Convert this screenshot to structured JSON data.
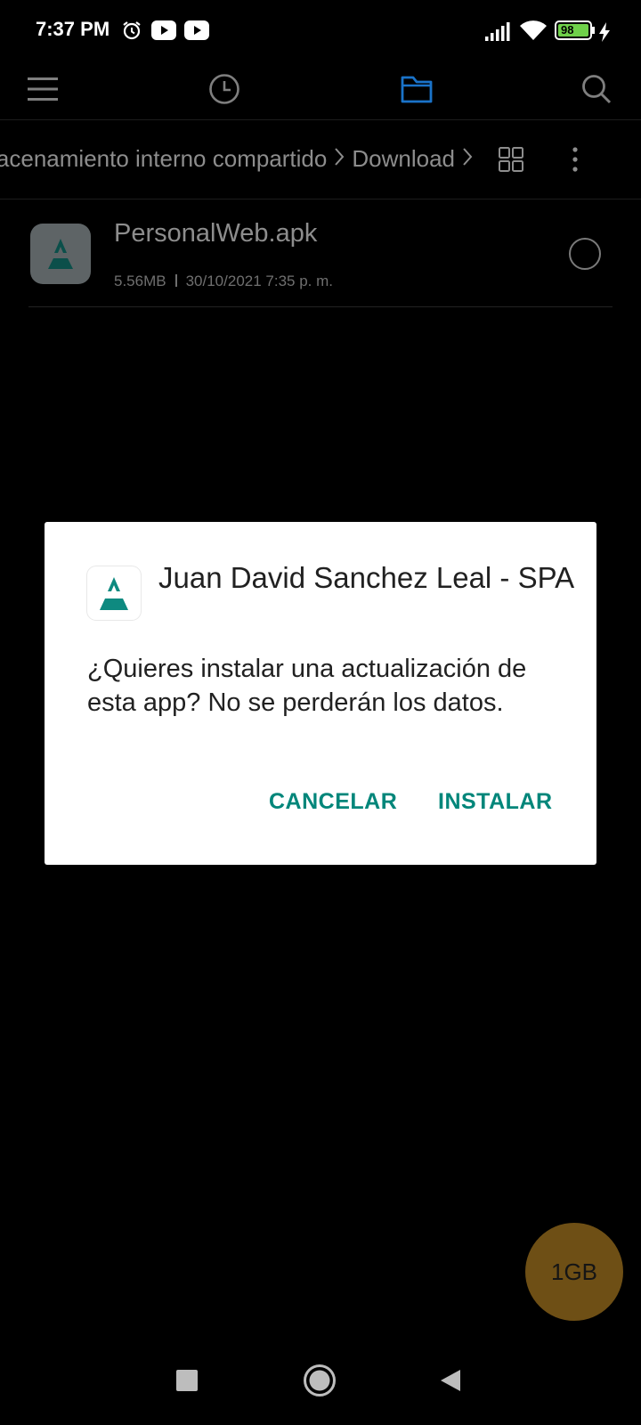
{
  "status_bar": {
    "time": "7:37 PM",
    "battery_level": "98",
    "icons": [
      "alarm-icon",
      "youtube-icon",
      "youtube-icon",
      "signal-icon",
      "wifi-icon",
      "battery-icon",
      "charging-icon"
    ]
  },
  "toolbar": {
    "icons": [
      "menu-icon",
      "history-icon",
      "folder-icon",
      "search-icon"
    ],
    "active_tab": "folder",
    "accent_color": "#1a73c9"
  },
  "breadcrumb": {
    "path": [
      "Almacenamiento interno compartido",
      "Download"
    ],
    "view_icon": "grid-view-icon",
    "more_icon": "more-vertical-icon"
  },
  "file": {
    "name": "PersonalWeb.apk",
    "size": "5.56MB",
    "date": "30/10/2021 7:35 p. m."
  },
  "dialog": {
    "title": "Juan David Sanchez Leal - SPA",
    "message": "¿Quieres instalar una actualización de esta app? No se perderán los datos.",
    "cancel_label": "CANCELAR",
    "install_label": "INSTALAR",
    "button_color": "#00867a"
  },
  "storage_fab": {
    "label": "1GB",
    "color": "#6e4f15"
  },
  "nav_bar": {
    "icons": [
      "recents-icon",
      "home-icon",
      "back-icon"
    ]
  }
}
